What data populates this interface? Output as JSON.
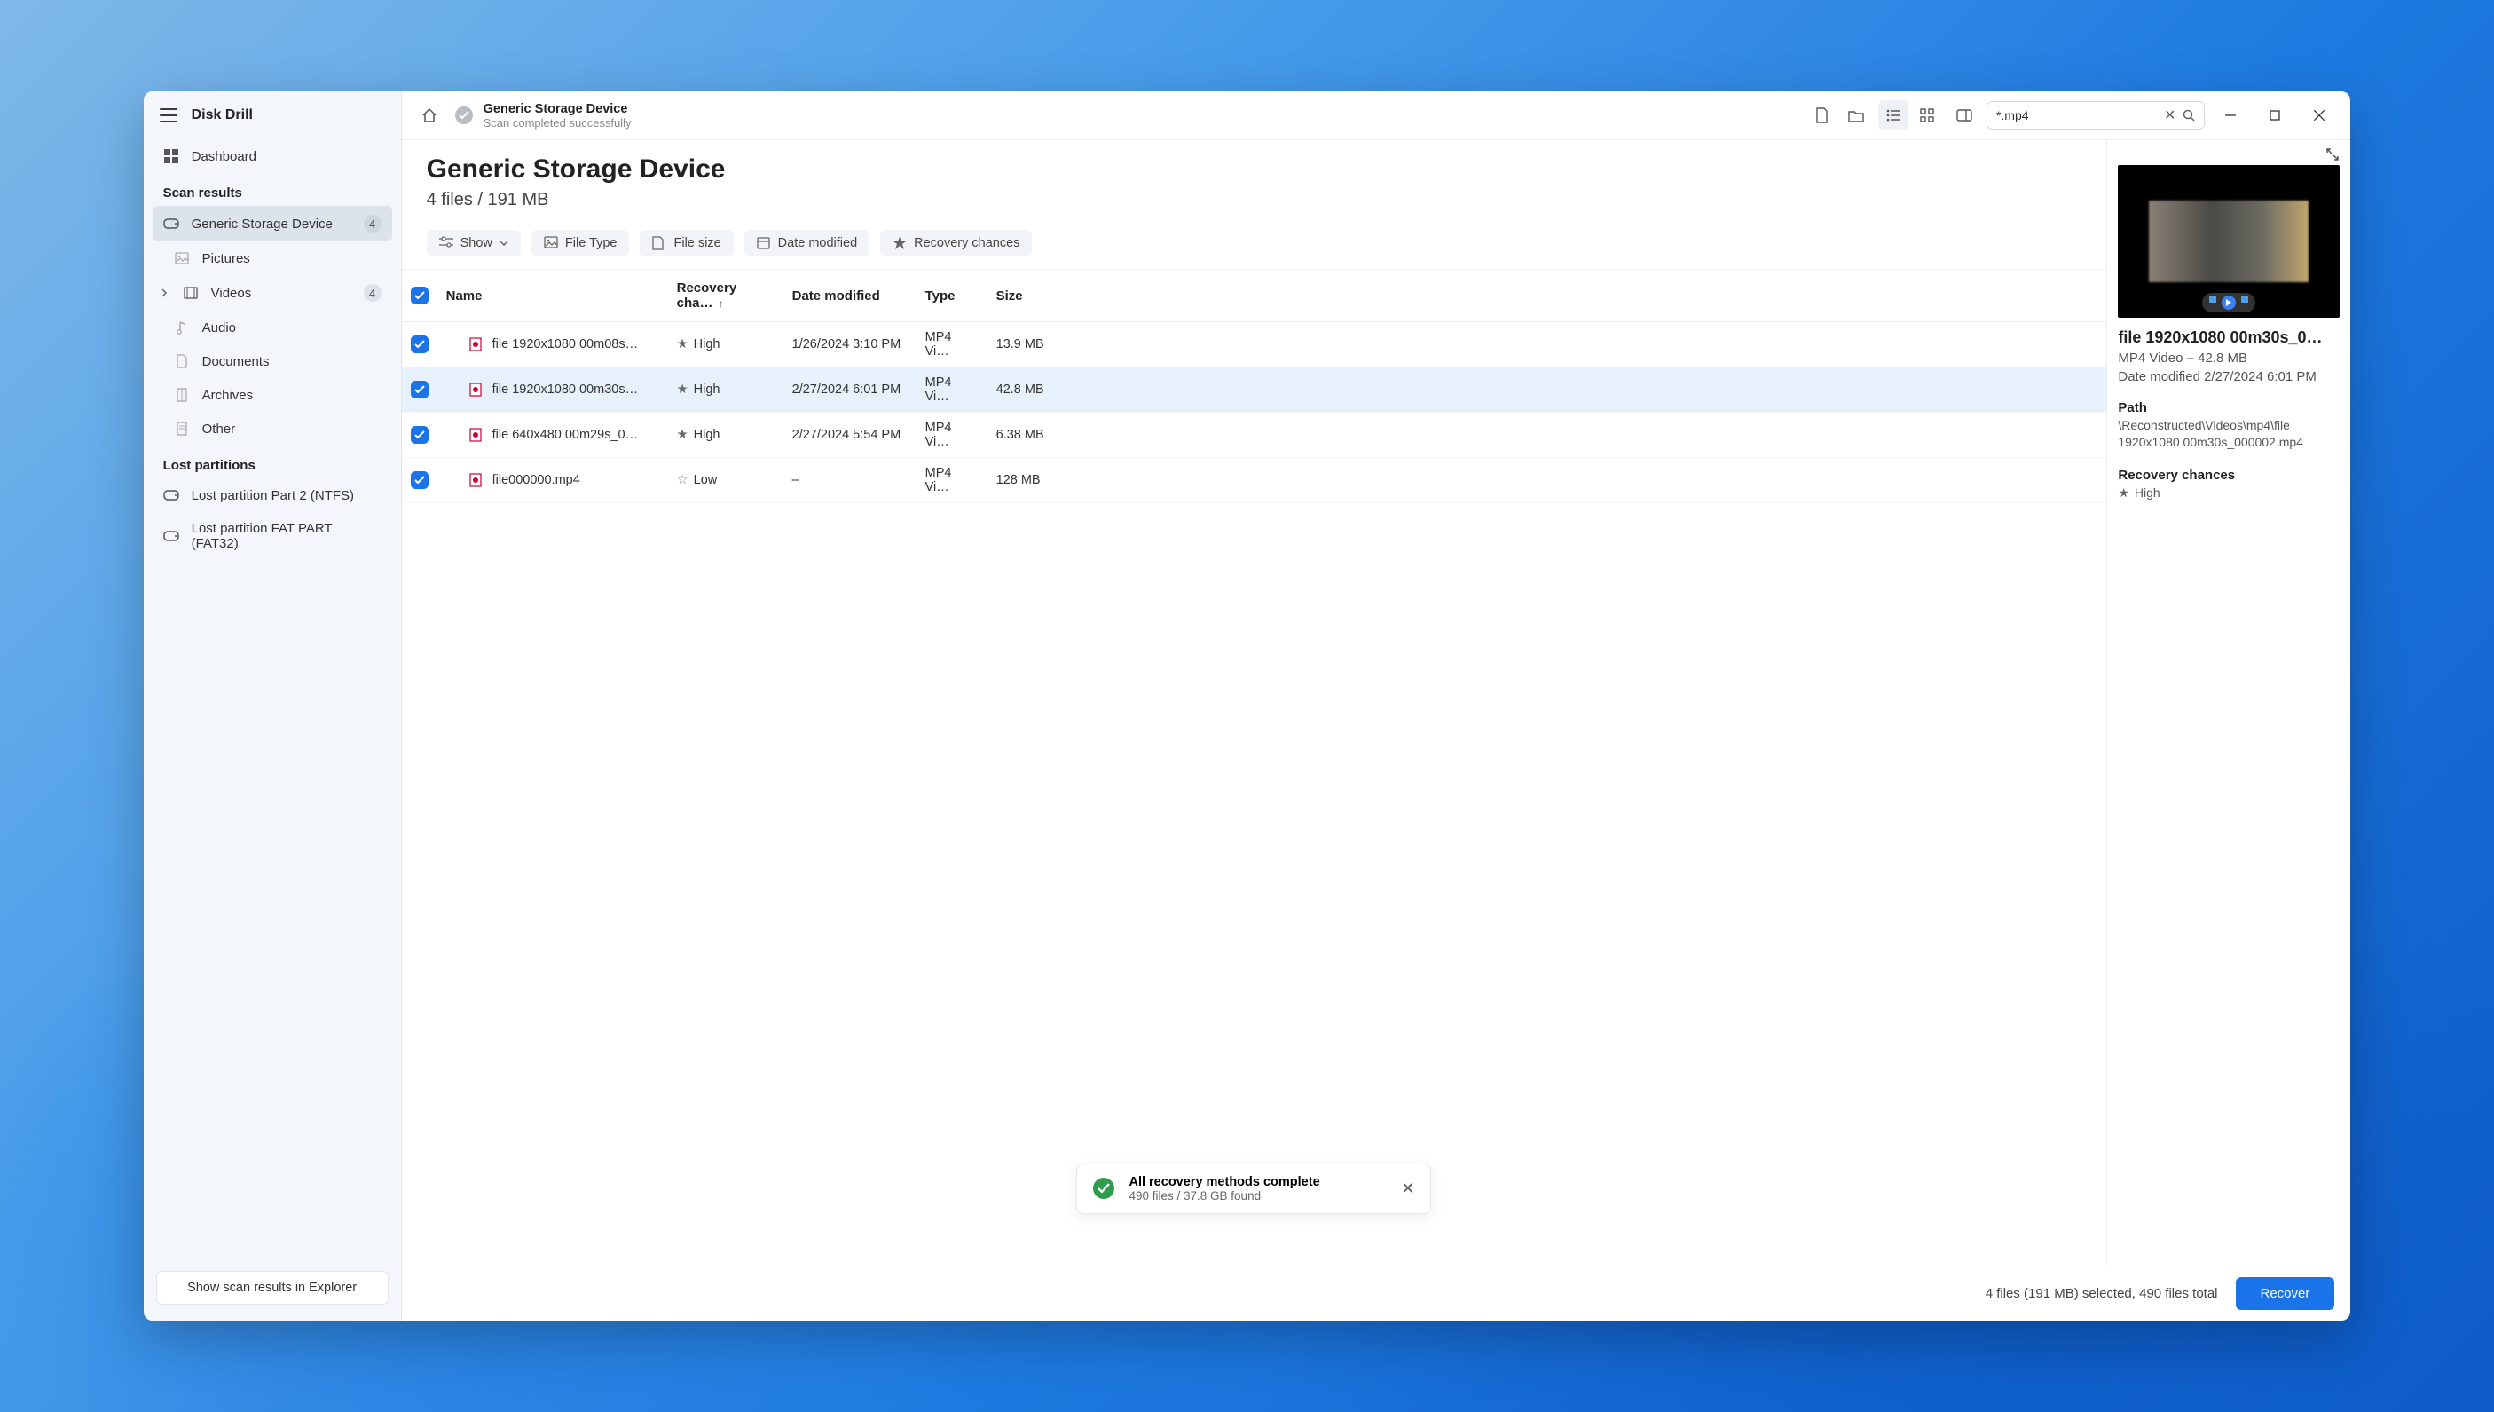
{
  "app": {
    "title": "Disk Drill"
  },
  "sidebar": {
    "dashboard_label": "Dashboard",
    "scan_results_header": "Scan results",
    "lost_partitions_header": "Lost partitions",
    "items": [
      {
        "label": "Generic Storage Device",
        "badge": "4"
      },
      {
        "label": "Pictures"
      },
      {
        "label": "Videos",
        "badge": "4"
      },
      {
        "label": "Audio"
      },
      {
        "label": "Documents"
      },
      {
        "label": "Archives"
      },
      {
        "label": "Other"
      }
    ],
    "lost_partitions": [
      {
        "label": "Lost partition Part 2 (NTFS)"
      },
      {
        "label": "Lost partition FAT PART (FAT32)"
      }
    ],
    "footer_button": "Show scan results in Explorer"
  },
  "topbar": {
    "title": "Generic Storage Device",
    "subtitle": "Scan completed successfully",
    "search_value": "*.mp4"
  },
  "page": {
    "title": "Generic Storage Device",
    "subtitle": "4 files / 191 MB"
  },
  "filters": {
    "show": "Show",
    "filetype": "File Type",
    "filesize": "File size",
    "datemodified": "Date modified",
    "recovery": "Recovery chances"
  },
  "columns": {
    "name": "Name",
    "recovery": "Recovery cha…",
    "date": "Date modified",
    "type": "Type",
    "size": "Size"
  },
  "rows": [
    {
      "name": "file 1920x1080 00m08s…",
      "recovery": "High",
      "filled": true,
      "date": "1/26/2024 3:10 PM",
      "type": "MP4 Vi…",
      "size": "13.9 MB"
    },
    {
      "name": "file 1920x1080 00m30s…",
      "recovery": "High",
      "filled": true,
      "date": "2/27/2024 6:01 PM",
      "type": "MP4 Vi…",
      "size": "42.8 MB"
    },
    {
      "name": "file 640x480 00m29s_0…",
      "recovery": "High",
      "filled": true,
      "date": "2/27/2024 5:54 PM",
      "type": "MP4 Vi…",
      "size": "6.38 MB"
    },
    {
      "name": "file000000.mp4",
      "recovery": "Low",
      "filled": false,
      "date": "–",
      "type": "MP4 Vi…",
      "size": "128 MB"
    }
  ],
  "toast": {
    "title": "All recovery methods complete",
    "subtitle": "490 files / 37.8 GB found"
  },
  "details": {
    "title": "file 1920x1080 00m30s_0…",
    "type_size": "MP4 Video – 42.8 MB",
    "date_label": "Date modified 2/27/2024 6:01 PM",
    "path_header": "Path",
    "path_value": "\\Reconstructed\\Videos\\mp4\\file 1920x1080 00m30s_000002.mp4",
    "recovery_header": "Recovery chances",
    "recovery_value": "High"
  },
  "bottom": {
    "stats": "4 files (191 MB) selected, 490 files total",
    "recover": "Recover"
  }
}
